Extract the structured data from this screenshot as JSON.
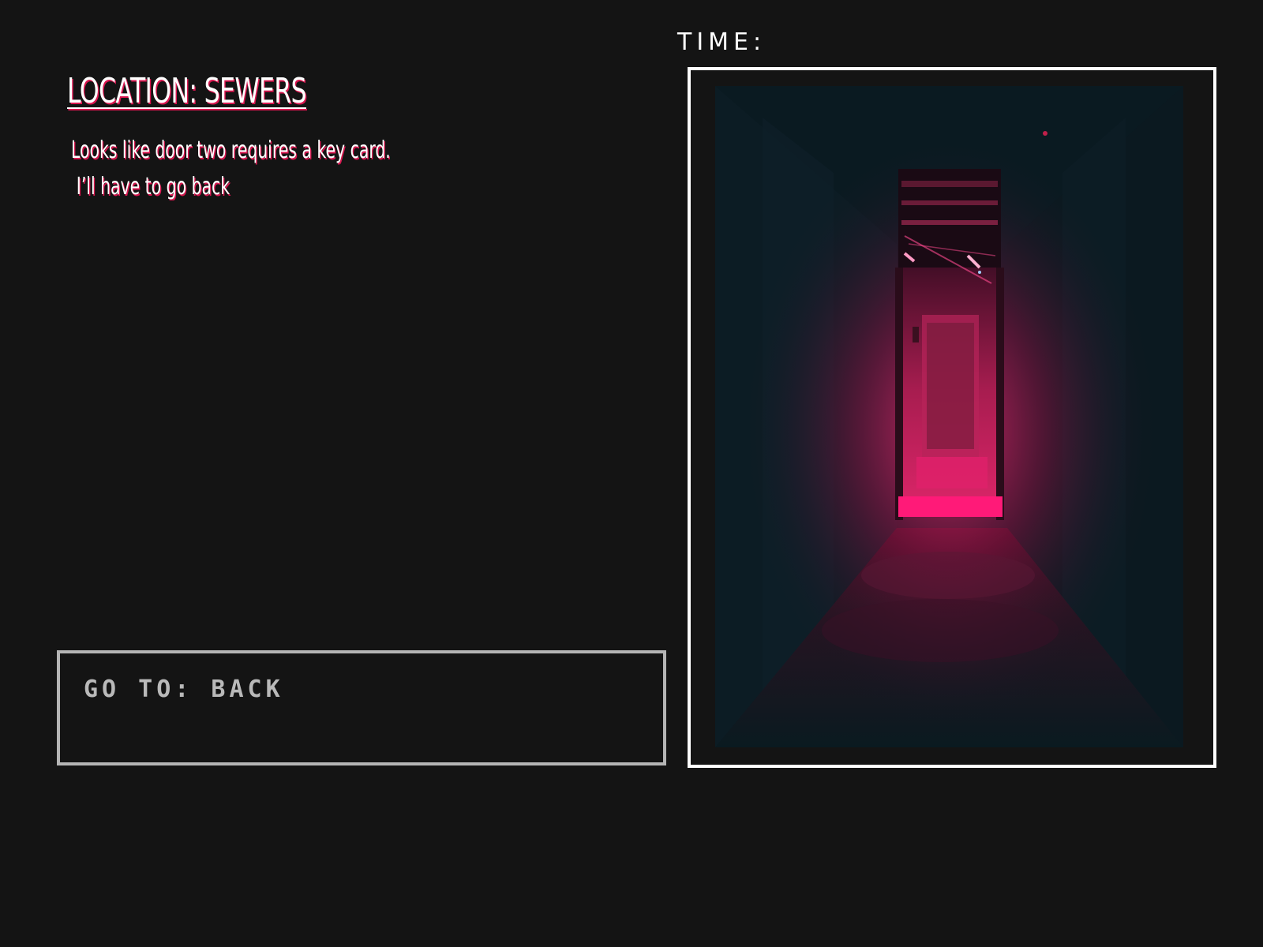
{
  "location": {
    "title": "LOCATION: SEWERS"
  },
  "narration": {
    "line1": "Looks like door two requires a key card.",
    "line2": "I’ll have to go back"
  },
  "time": {
    "label": "TIME:",
    "value": ""
  },
  "navigation": {
    "goto_label": "GO TO: BACK"
  },
  "scene": {
    "description_icon": "neon-corridor-image"
  },
  "colors": {
    "background": "#141414",
    "accent": "#d9164f",
    "text": "#ffffff",
    "box_border": "#b5b5b5"
  }
}
